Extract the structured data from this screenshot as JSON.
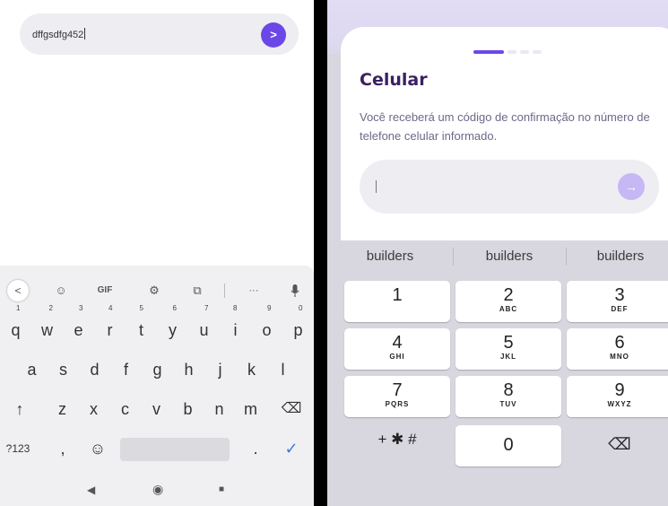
{
  "left": {
    "input": {
      "value": "dffgsdfg452"
    },
    "send_button": {
      "label": ">"
    },
    "keyboard": {
      "toolbar": {
        "back": "<",
        "sticker": "☺",
        "gif": "GIF",
        "settings": "⚙",
        "translate": "⧉",
        "more": "···",
        "mic": "🎙"
      },
      "row1": [
        {
          "key": "q",
          "hint": "1"
        },
        {
          "key": "w",
          "hint": "2"
        },
        {
          "key": "e",
          "hint": "3"
        },
        {
          "key": "r",
          "hint": "4"
        },
        {
          "key": "t",
          "hint": "5"
        },
        {
          "key": "y",
          "hint": "6"
        },
        {
          "key": "u",
          "hint": "7"
        },
        {
          "key": "i",
          "hint": "8"
        },
        {
          "key": "o",
          "hint": "9"
        },
        {
          "key": "p",
          "hint": "0"
        }
      ],
      "row2": [
        "a",
        "s",
        "d",
        "f",
        "g",
        "h",
        "j",
        "k",
        "l"
      ],
      "row3": {
        "shift": "↑",
        "letters": [
          "z",
          "x",
          "c",
          "v",
          "b",
          "n",
          "m"
        ],
        "backspace": "⌫"
      },
      "row4": {
        "symbols": "?123",
        "comma": ",",
        "emoji": "☺",
        "period": ".",
        "enter": "✓"
      }
    },
    "nav": {
      "back": "◀",
      "home": "◉",
      "recents": "■"
    }
  },
  "right": {
    "title": "Celular",
    "description": "Você receberá um código de confirmação no número de telefone celular informado.",
    "phone_input": {
      "placeholder": ""
    },
    "send_button": {
      "label": "→"
    },
    "progress": {
      "step": 1,
      "total": 4
    },
    "suggestions": [
      "builders",
      "builders",
      "builders"
    ],
    "keypad": [
      {
        "digit": "1",
        "letters": ""
      },
      {
        "digit": "2",
        "letters": "ABC"
      },
      {
        "digit": "3",
        "letters": "DEF"
      },
      {
        "digit": "4",
        "letters": "GHI"
      },
      {
        "digit": "5",
        "letters": "JKL"
      },
      {
        "digit": "6",
        "letters": "MNO"
      },
      {
        "digit": "7",
        "letters": "PQRS"
      },
      {
        "digit": "8",
        "letters": "TUV"
      },
      {
        "digit": "9",
        "letters": "WXYZ"
      }
    ],
    "keypad_bottom": {
      "symbols": "+ ✱ #",
      "zero": "0",
      "backspace": "⌫"
    }
  },
  "colors": {
    "accent": "#6c47e8",
    "accent_light": "#c6b8f5",
    "title": "#3a1f63"
  }
}
